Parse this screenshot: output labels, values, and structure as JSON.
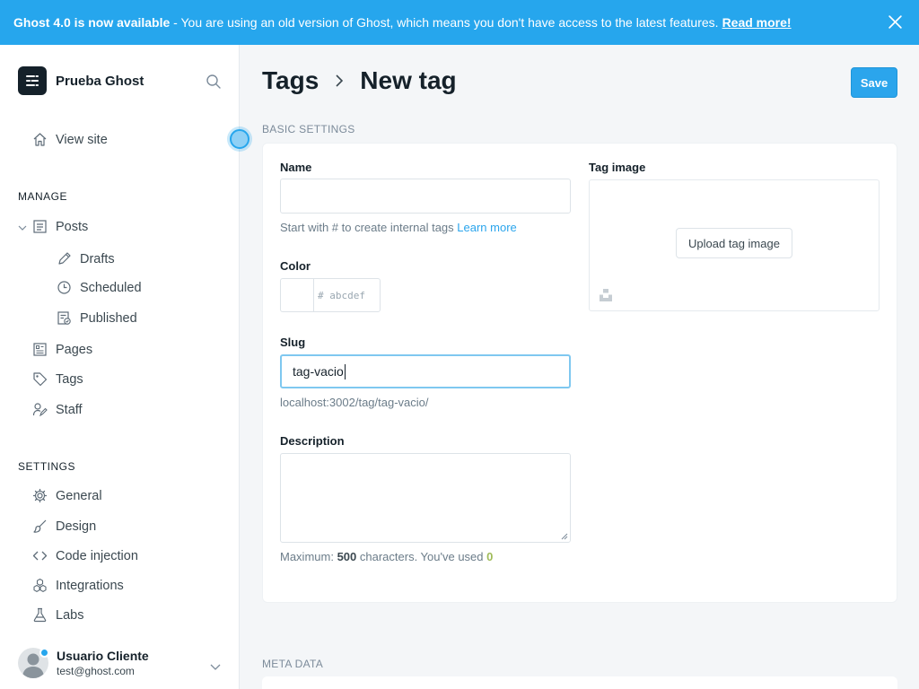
{
  "banner": {
    "title": "Ghost 4.0 is now available",
    "message": " - You are using an old version of Ghost, which means you don't have access to the latest features.",
    "link": "Read more!"
  },
  "sidebar": {
    "site_name": "Prueba Ghost",
    "view_site": "View site",
    "manage_title": "MANAGE",
    "settings_title": "SETTINGS",
    "manage_items": [
      "Posts",
      "Drafts",
      "Scheduled",
      "Published",
      "Pages",
      "Tags",
      "Staff"
    ],
    "settings_items": [
      "General",
      "Design",
      "Code injection",
      "Integrations",
      "Labs"
    ]
  },
  "user": {
    "name": "Usuario Cliente",
    "email": "test@ghost.com"
  },
  "header": {
    "crumb_parent": "Tags",
    "crumb_current": "New tag",
    "save_label": "Save"
  },
  "form": {
    "basic_title": "BASIC SETTINGS",
    "meta_title": "META DATA",
    "name_label": "Name",
    "name_value": "",
    "name_hint": "Start with # to create internal tags",
    "name_hint_link": "Learn more",
    "color_label": "Color",
    "color_prefix": "#",
    "color_placeholder": "abcdef",
    "color_value": "",
    "slug_label": "Slug",
    "slug_value": "tag-vacio",
    "slug_url": "localhost:3002/tag/tag-vacio/",
    "description_label": "Description",
    "description_value": "",
    "desc_hint_pre": "Maximum: ",
    "desc_max": "500",
    "desc_hint_mid": " characters. You've used ",
    "desc_used": "0",
    "image_label": "Tag image",
    "upload_label": "Upload tag image"
  },
  "colors": {
    "accent": "#26a6ed",
    "save": "#2ba5ec",
    "green": "#9fbb58"
  }
}
